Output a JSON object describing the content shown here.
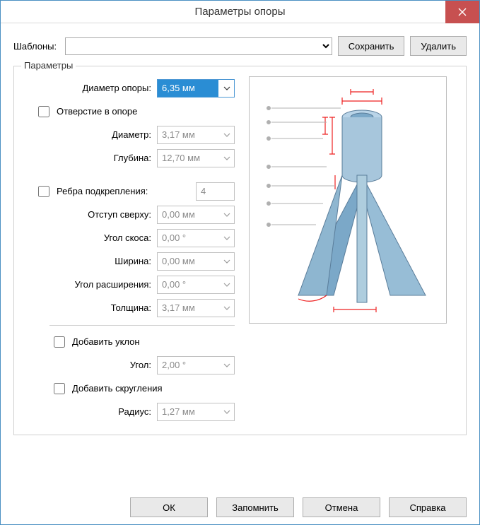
{
  "window": {
    "title": "Параметры опоры"
  },
  "templates": {
    "label": "Шаблоны:",
    "value": "",
    "saveBtn": "Сохранить",
    "deleteBtn": "Удалить"
  },
  "params": {
    "legend": "Параметры",
    "bossDiameter": {
      "label": "Диаметр опоры:",
      "value": "6,35 мм"
    },
    "holeInBoss": {
      "label": "Отверстие в опоре",
      "checked": false
    },
    "holeDiameter": {
      "label": "Диаметр:",
      "value": "3,17 мм"
    },
    "holeDepth": {
      "label": "Глубина:",
      "value": "12,70 мм"
    },
    "ribs": {
      "label": "Ребра подкрепления:",
      "checked": false,
      "count": "4"
    },
    "offsetTop": {
      "label": "Отступ сверху:",
      "value": "0,00 мм"
    },
    "bevelAngle": {
      "label": "Угол скоса:",
      "value": "0,00 °"
    },
    "width": {
      "label": "Ширина:",
      "value": "0,00 мм"
    },
    "expandAngle": {
      "label": "Угол расширения:",
      "value": "0,00 °"
    },
    "thickness": {
      "label": "Толщина:",
      "value": "3,17 мм"
    },
    "addDraft": {
      "label": "Добавить уклон",
      "checked": false
    },
    "draftAngle": {
      "label": "Угол:",
      "value": "2,00 °"
    },
    "addFillet": {
      "label": "Добавить скругления",
      "checked": false
    },
    "filletRadius": {
      "label": "Радиус:",
      "value": "1,27 мм"
    }
  },
  "buttons": {
    "ok": "ОК",
    "remember": "Запомнить",
    "cancel": "Отмена",
    "help": "Справка"
  }
}
